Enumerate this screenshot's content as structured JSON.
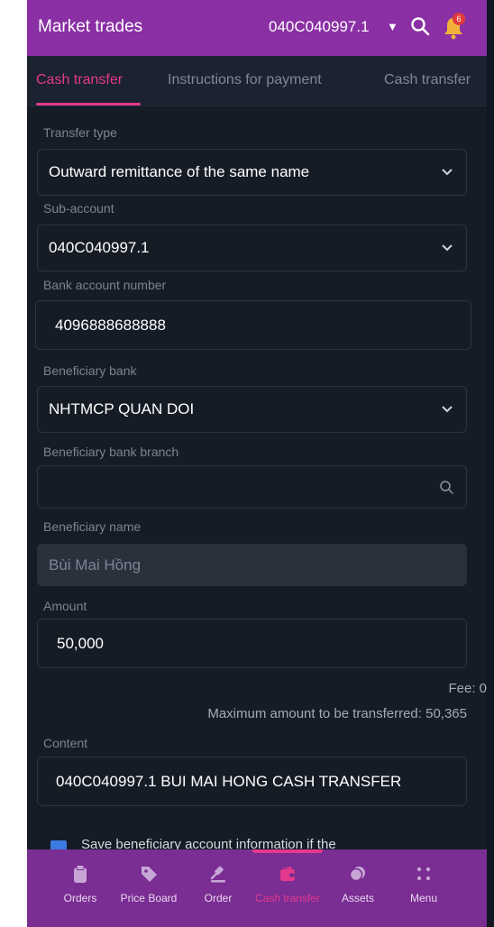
{
  "header": {
    "title": "Market trades",
    "account": "040C040997.1",
    "notification_count": "6"
  },
  "tabs": [
    {
      "label": "Cash transfer",
      "active": true
    },
    {
      "label": "Instructions for payment",
      "active": false
    },
    {
      "label": "Cash transfer",
      "active": false
    }
  ],
  "form": {
    "transfer_type": {
      "label": "Transfer type",
      "value": "Outward remittance of the same name"
    },
    "sub_account": {
      "label": "Sub-account",
      "value": "040C040997.1"
    },
    "bank_account_number": {
      "label": "Bank account number",
      "value": "4096888688888"
    },
    "beneficiary_bank": {
      "label": "Beneficiary bank",
      "value": "NHTMCP QUAN DOI"
    },
    "beneficiary_bank_branch": {
      "label": "Beneficiary bank branch",
      "value": ""
    },
    "beneficiary_name": {
      "label": "Beneficiary name",
      "value": "Bùi Mai Hồng"
    },
    "amount": {
      "label": "Amount",
      "value": "50,000"
    },
    "fee": "Fee: 0",
    "max_amount": "Maximum amount to be transferred: 50,365",
    "content": {
      "label": "Content",
      "value": "040C040997.1 BUI MAI HONG CASH TRANSFER"
    },
    "save_beneficiary_text": "Save beneficiary account information if the"
  },
  "bottom_nav": [
    {
      "label": "Orders",
      "icon": "clipboard-icon",
      "active": false
    },
    {
      "label": "Price Board",
      "icon": "tag-icon",
      "active": false
    },
    {
      "label": "Order",
      "icon": "gavel-icon",
      "active": false
    },
    {
      "label": "Cash transfer",
      "icon": "wallet-icon",
      "active": true
    },
    {
      "label": "Assets",
      "icon": "coins-icon",
      "active": false
    },
    {
      "label": "Menu",
      "icon": "grid-dots-icon",
      "active": false
    }
  ],
  "colors": {
    "brand_purple": "#8a2fa4",
    "accent_pink": "#e4398c",
    "background": "#161c26"
  }
}
